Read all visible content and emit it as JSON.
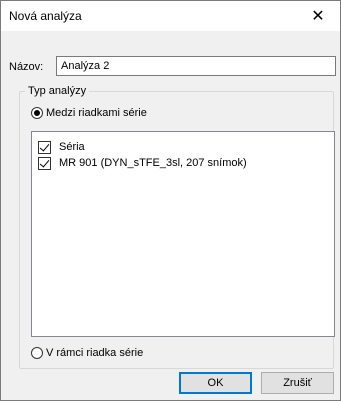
{
  "dialog": {
    "title": "Nová analýza",
    "close_glyph": "✕"
  },
  "name_field": {
    "label": "Názov:",
    "value": "Analýza 2"
  },
  "analysis_type": {
    "legend": "Typ analýzy",
    "option_between": {
      "label": "Medzi riadkami série",
      "selected": true
    },
    "option_within": {
      "label": "V rámci riadka série",
      "selected": false
    }
  },
  "series_list": {
    "items": [
      {
        "label": "Séria",
        "checked": true
      },
      {
        "label": "MR 901 (DYN_sTFE_3sl, 207 snímok)",
        "checked": true
      }
    ]
  },
  "buttons": {
    "ok_label": "OK",
    "cancel_label": "Zrušiť"
  },
  "colors": {
    "default_button_border": "#0078d7",
    "dialog_background": "#f0f0f0"
  }
}
